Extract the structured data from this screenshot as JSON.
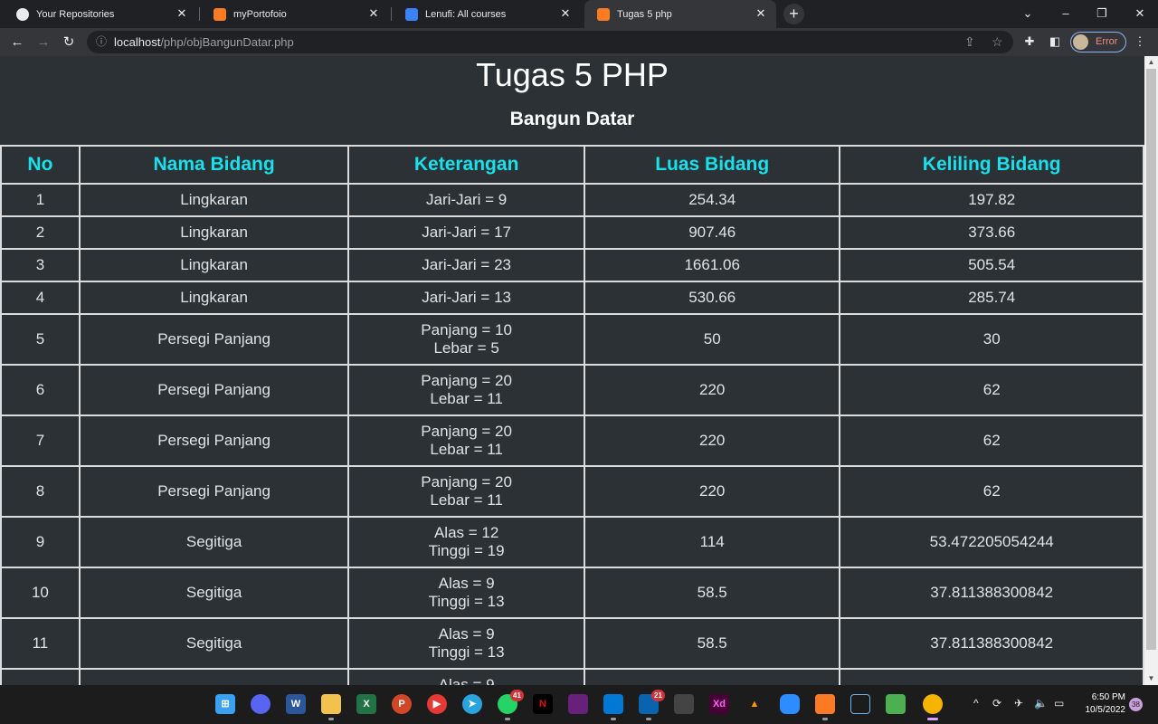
{
  "browser": {
    "tabs": [
      {
        "title": "Your Repositories",
        "icon": "github-icon",
        "color": "#e8eaed"
      },
      {
        "title": "myPortofoio",
        "icon": "xampp-icon",
        "color": "#fb7a24"
      },
      {
        "title": "Lenufi: All courses",
        "icon": "lenufi-icon",
        "color": "#3b82f6"
      },
      {
        "title": "Tugas 5 php",
        "icon": "xampp-icon",
        "color": "#fb7a24"
      }
    ],
    "url_host": "localhost",
    "url_path": "/php/objBangunDatar.php",
    "profile_label": "Error"
  },
  "page": {
    "title": "Tugas 5 PHP",
    "subtitle": "Bangun Datar",
    "columns": [
      "No",
      "Nama Bidang",
      "Keterangan",
      "Luas Bidang",
      "Keliling Bidang"
    ],
    "rows": [
      {
        "no": "1",
        "nama": "Lingkaran",
        "ket1": "Jari-Jari = 9",
        "ket2": "",
        "luas": "254.34",
        "keliling": "197.82"
      },
      {
        "no": "2",
        "nama": "Lingkaran",
        "ket1": "Jari-Jari = 17",
        "ket2": "",
        "luas": "907.46",
        "keliling": "373.66"
      },
      {
        "no": "3",
        "nama": "Lingkaran",
        "ket1": "Jari-Jari = 23",
        "ket2": "",
        "luas": "1661.06",
        "keliling": "505.54"
      },
      {
        "no": "4",
        "nama": "Lingkaran",
        "ket1": "Jari-Jari = 13",
        "ket2": "",
        "luas": "530.66",
        "keliling": "285.74"
      },
      {
        "no": "5",
        "nama": "Persegi Panjang",
        "ket1": "Panjang = 10",
        "ket2": "Lebar = 5",
        "luas": "50",
        "keliling": "30"
      },
      {
        "no": "6",
        "nama": "Persegi Panjang",
        "ket1": "Panjang = 20",
        "ket2": "Lebar = 11",
        "luas": "220",
        "keliling": "62"
      },
      {
        "no": "7",
        "nama": "Persegi Panjang",
        "ket1": "Panjang = 20",
        "ket2": "Lebar = 11",
        "luas": "220",
        "keliling": "62"
      },
      {
        "no": "8",
        "nama": "Persegi Panjang",
        "ket1": "Panjang = 20",
        "ket2": "Lebar = 11",
        "luas": "220",
        "keliling": "62"
      },
      {
        "no": "9",
        "nama": "Segitiga",
        "ket1": "Alas = 12",
        "ket2": "Tinggi = 19",
        "luas": "114",
        "keliling": "53.472205054244"
      },
      {
        "no": "10",
        "nama": "Segitiga",
        "ket1": "Alas = 9",
        "ket2": "Tinggi = 13",
        "luas": "58.5",
        "keliling": "37.811388300842"
      },
      {
        "no": "11",
        "nama": "Segitiga",
        "ket1": "Alas = 9",
        "ket2": "Tinggi = 13",
        "luas": "58.5",
        "keliling": "37.811388300842"
      },
      {
        "no": "",
        "nama": "",
        "ket1": "Alas = 9",
        "ket2": "",
        "luas": "",
        "keliling": ""
      }
    ]
  },
  "taskbar": {
    "whatsapp_badge": "41",
    "mail_badge": "21",
    "time": "6:50 PM",
    "date": "10/5/2022",
    "notifications": "38"
  },
  "colors": {
    "header_text": "#19e1ec",
    "page_bg": "#2b3135"
  }
}
